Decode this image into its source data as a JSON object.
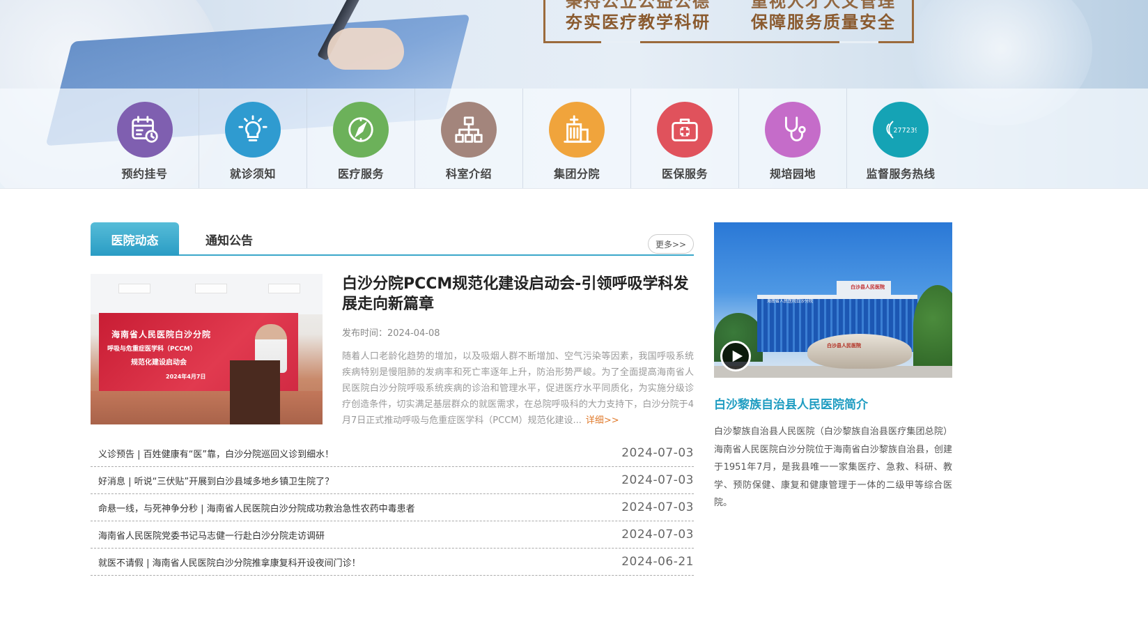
{
  "banner": {
    "slogan_line1_left": "秉持公立公益公德",
    "slogan_line1_right": "重视人才人文管理",
    "slogan_line2_left": "夯实医疗教学科研",
    "slogan_line2_right": "保障服务质量安全"
  },
  "quick_nav": {
    "items": [
      {
        "label": "预约挂号",
        "icon": "calendar-clock-icon",
        "color": "#7f5fb0"
      },
      {
        "label": "就诊须知",
        "icon": "lightbulb-icon",
        "color": "#2f9bd0"
      },
      {
        "label": "医疗服务",
        "icon": "compass-icon",
        "color": "#6cb15a"
      },
      {
        "label": "科室介绍",
        "icon": "org-chart-icon",
        "color": "#a3857c"
      },
      {
        "label": "集团分院",
        "icon": "hospital-building-icon",
        "color": "#f0a43c"
      },
      {
        "label": "医保服务",
        "icon": "medical-kit-icon",
        "color": "#e0525c"
      },
      {
        "label": "规培园地",
        "icon": "stethoscope-icon",
        "color": "#c56cc9"
      },
      {
        "label": "监督服务热线",
        "icon": "phone-hotline-icon",
        "color": "#15a3b5",
        "hotline": "27723920"
      }
    ]
  },
  "news": {
    "tabs": [
      {
        "label": "医院动态",
        "active": true
      },
      {
        "label": "通知公告",
        "active": false
      }
    ],
    "more_label": "更多>>",
    "feature": {
      "title": "白沙分院PCCM规范化建设启动会-引领呼吸学科发展走向新篇章",
      "date_label": "发布时间：",
      "date": "2024-04-08",
      "summary": "随着人口老龄化趋势的增加，以及吸烟人群不断增加、空气污染等因素，我国呼吸系统疾病特别是慢阻肺的发病率和死亡率逐年上升，防治形势严峻。为了全面提高海南省人民医院白沙分院呼吸系统疾病的诊治和管理水平，促进医疗水平同质化，为实施分级诊疗创造条件，切实满足基层群众的就医需求，在总院呼吸科的大力支持下，白沙分院于4月7日正式推动呼吸与危重症医学科（PCCM）规范化建设...",
      "detail_label": "详细>>",
      "photo_text": {
        "line1": "海南省人民医院白沙分院",
        "line2": "呼吸与危重症医学科（PCCM）",
        "line3": "规范化建设启动会",
        "line4": "2024年4月7日"
      }
    },
    "items": [
      {
        "title": "义诊预告 | 百姓健康有“医”靠，白沙分院巡回义诊到细水！",
        "date": "2024-07-03"
      },
      {
        "title": "好消息 | 听说“三伏贴”开展到白沙县域多地乡镇卫生院了？",
        "date": "2024-07-03"
      },
      {
        "title": "命悬一线，与死神争分秒 | 海南省人民医院白沙分院成功救治急性农药中毒患者",
        "date": "2024-07-03"
      },
      {
        "title": "海南省人民医院党委书记马志健一行赴白沙分院走访调研",
        "date": "2024-07-03"
      },
      {
        "title": "就医不请假 | 海南省人民医院白沙分院推拿康复科开设夜间门诊！",
        "date": "2024-06-21"
      }
    ]
  },
  "intro": {
    "title": "白沙黎族自治县人民医院简介",
    "text": "白沙黎族自治县人民医院（白沙黎族自治县医疗集团总院）海南省人民医院白沙分院位于海南省白沙黎族自治县，创建于1951年7月，是我县唯一一家集医疗、急救、科研、教学、预防保健、康复和健康管理于一体的二级甲等综合医院。",
    "photo_text": {
      "building_sign": "白沙县人民医院",
      "facade_sign": "海南省人民医院白沙分院",
      "rock_text": "白沙县人民医院"
    }
  }
}
